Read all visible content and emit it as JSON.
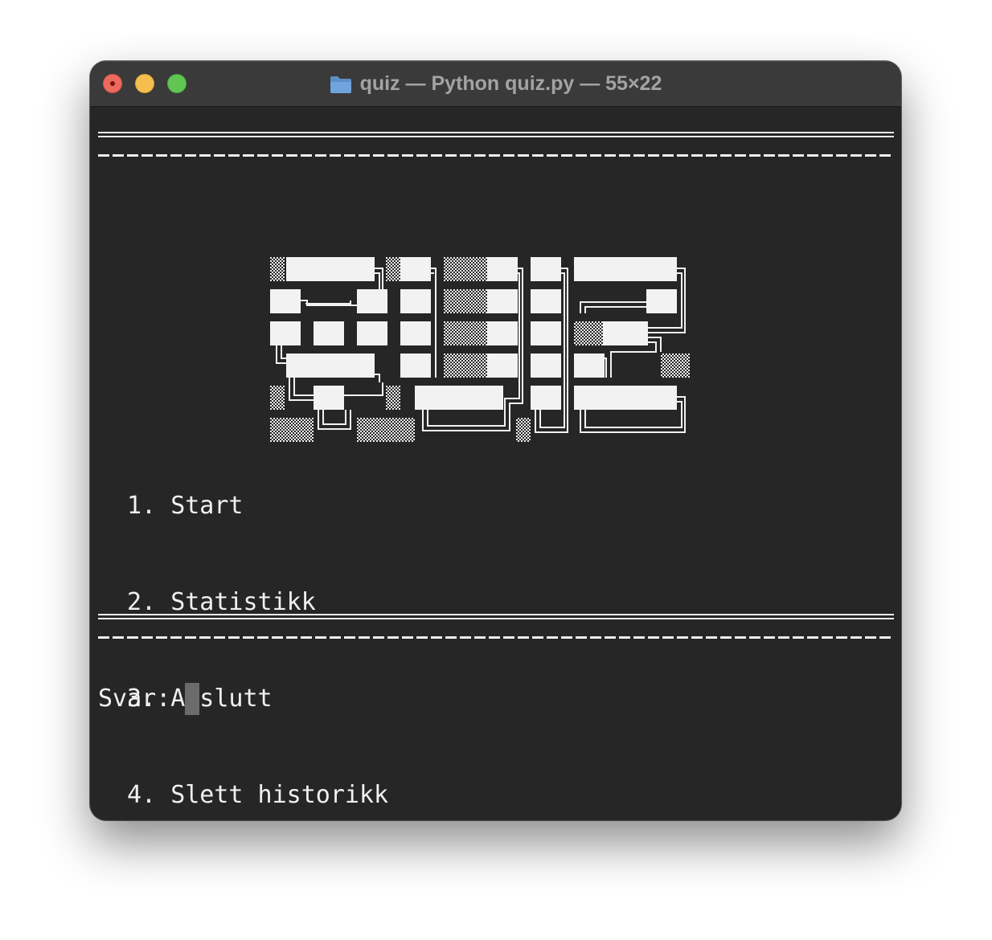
{
  "window": {
    "title": "quiz — Python quiz.py — 55×22",
    "title_icon": "folder-icon",
    "traffic_lights": [
      "close",
      "minimize",
      "maximize"
    ]
  },
  "terminal": {
    "banner_word": "QUIZ",
    "menu": [
      {
        "number": "1.",
        "label": "Start"
      },
      {
        "number": "2.",
        "label": "Statistikk"
      },
      {
        "number": "3.",
        "label": "Avslutt"
      },
      {
        "number": "4.",
        "label": "Slett historikk"
      }
    ],
    "prompt_label": "Svar:",
    "input_value": ""
  },
  "colors": {
    "background": "#262626",
    "text": "#f0f0f0",
    "titlebar": "#3a3a3a",
    "title_text": "#a3a3a3",
    "close": "#ed6a5e",
    "minimize": "#f5bf4f",
    "maximize": "#61c554",
    "cursor": "#6b6b6b"
  }
}
